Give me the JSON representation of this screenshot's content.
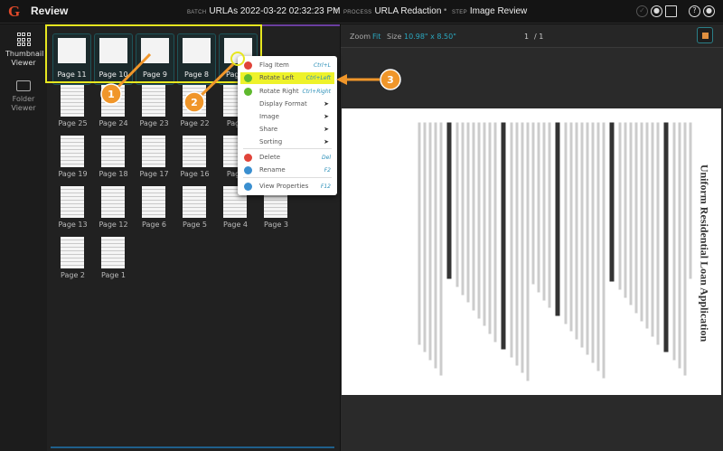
{
  "header": {
    "logo": "G",
    "title": "Review",
    "batch_label": "BATCH",
    "batch": "URLAs 2022-03-22 02:32:23 PM",
    "process_label": "PROCESS",
    "process": "URLA Redaction",
    "step_label": "STEP",
    "step": "Image Review"
  },
  "nav": [
    {
      "label": "Thumbnail Viewer",
      "icon": "grid-icon"
    },
    {
      "label": "Folder Viewer",
      "icon": "folder-icon"
    }
  ],
  "selected": [
    "Page 11",
    "Page 10",
    "Page 9",
    "Page 8",
    "Page 7"
  ],
  "thumbs": [
    [
      "Page 25",
      "Page 24",
      "Page 23",
      "Page 22",
      "Page",
      ""
    ],
    [
      "Page 19",
      "Page 18",
      "Page 17",
      "Page 16",
      "Page",
      ""
    ],
    [
      "Page 13",
      "Page 12",
      "Page 6",
      "Page 5",
      "Page 4",
      "Page 3"
    ],
    [
      "Page 2",
      "Page 1"
    ]
  ],
  "viewer": {
    "zoom_label": "Zoom",
    "zoom": "Fit",
    "size_label": "Size",
    "size": "10.98\" x 8.50\"",
    "page": "1",
    "total": "/ 1",
    "doc_title": "Uniform Residential Loan Application"
  },
  "menu": [
    {
      "label": "Flag Item",
      "shortcut": "Ctrl+L",
      "icon": "flag-icon",
      "color": "#e0443a"
    },
    {
      "label": "Rotate Left",
      "shortcut": "Ctrl+Left",
      "icon": "rotate-left-icon",
      "color": "#5fb92e",
      "highlight": true
    },
    {
      "label": "Rotate Right",
      "shortcut": "Ctrl+Right",
      "icon": "rotate-right-icon",
      "color": "#5fb92e"
    },
    {
      "label": "Display Format",
      "submenu": true
    },
    {
      "label": "Image",
      "submenu": true
    },
    {
      "label": "Share",
      "submenu": true
    },
    {
      "label": "Sorting",
      "submenu": true
    },
    {
      "label": "Delete",
      "shortcut": "Del",
      "icon": "delete-icon",
      "color": "#e0443a"
    },
    {
      "label": "Rename",
      "shortcut": "F2",
      "icon": "rename-icon",
      "color": "#3a8fd0"
    },
    {
      "label": "View Properties",
      "shortcut": "F12",
      "icon": "properties-icon",
      "color": "#3a8fd0"
    }
  ],
  "callouts": [
    "1",
    "2",
    "3"
  ],
  "colors": {
    "accent": "#2ba8c0",
    "highlight": "#e6e620",
    "callout": "#f0962a"
  }
}
